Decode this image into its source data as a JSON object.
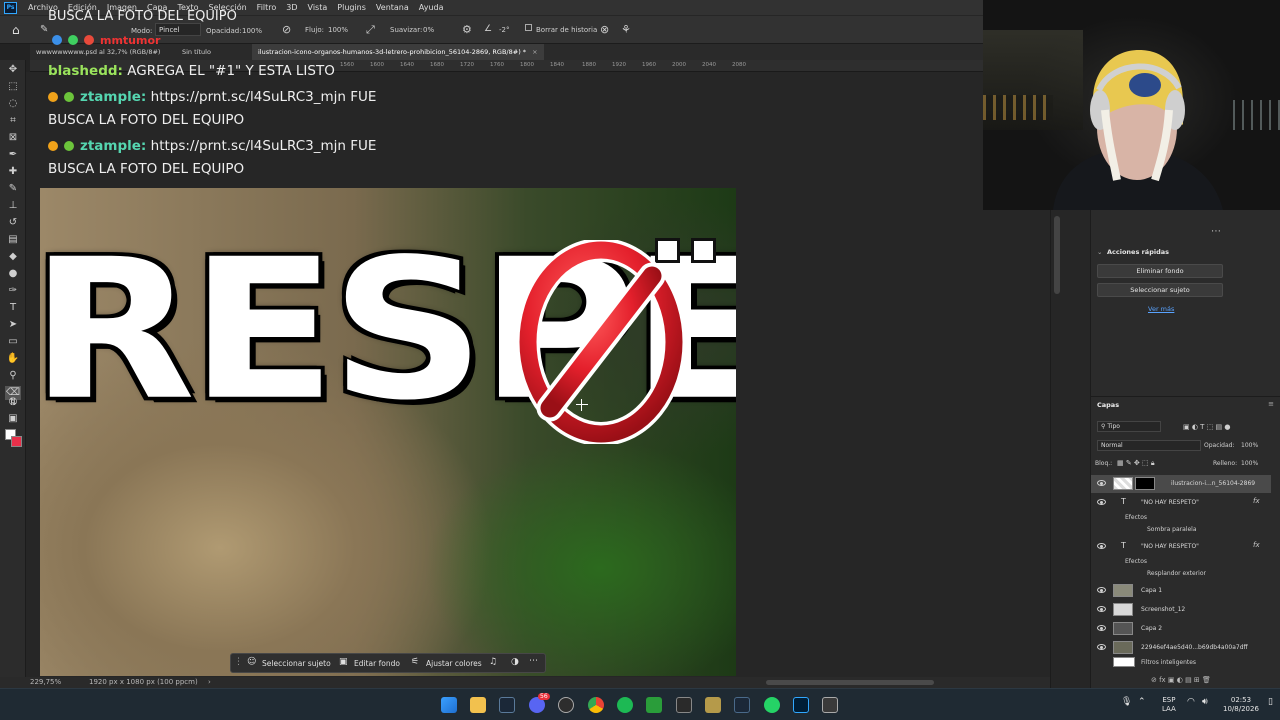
{
  "menu": {
    "items": [
      "Archivo",
      "Edición",
      "Imagen",
      "Capa",
      "Texto",
      "Selección",
      "Filtro",
      "3D",
      "Vista",
      "Plugins",
      "Ventana",
      "Ayuda"
    ]
  },
  "options": {
    "mode_label": "Modo:",
    "mode_value": "Pincel",
    "opacity_label": "Opacidad:",
    "opacity_value": "100%",
    "flow_label": "Flujo:",
    "flow_value": "100%",
    "smooth_label": "Suavizar:",
    "smooth_value": "0%",
    "angle_value": "-2°",
    "history_label": "Borrar de historia"
  },
  "tabs": {
    "tab1": "wwwwwwwww.psd al 32,7% (RGB/8#)",
    "tab2": "Sin título",
    "tab3": "ilustracion-icono-organos-humanos-3d-letrero-prohibicion_56104-2869, RGB/8#) *",
    "close": "×"
  },
  "ruler": {
    "ticks": [
      "1560",
      "1600",
      "1640",
      "1680",
      "1720",
      "1760",
      "1800",
      "1840",
      "1880",
      "1920",
      "1960",
      "2000",
      "2040",
      "2080"
    ]
  },
  "chat": {
    "top_partial": "BUSCA LA FOTO DEL EQUIPO",
    "overlay_name": "mmtumor",
    "messages": [
      {
        "user": "blashedd:",
        "user_color": "#9ae35c",
        "text": " AGREGA EL \"#1\" Y ESTA LISTO"
      },
      {
        "user": "ztample:",
        "user_color": "#55d6b0",
        "text": " https://prnt.sc/l4SuLRC3_mjn FUE",
        "cont": "BUSCA LA FOTO DEL EQUIPO"
      },
      {
        "user": "ztample:",
        "user_color": "#55d6b0",
        "text": " https://prnt.sc/l4SuLRC3_mjn FUE",
        "cont": "BUSCA LA FOTO DEL EQUIPO"
      }
    ]
  },
  "canvas": {
    "headline": "RESPETO",
    "no_sign_color": "#e4202c"
  },
  "context_bar": {
    "select_subject": "Seleccionar sujeto",
    "edit_background": "Editar fondo",
    "adjust_colors": "Ajustar colores"
  },
  "status": {
    "zoom": "229,75%",
    "doc_size": "1920 px x 1080 px (100 ppcm)"
  },
  "properties": {
    "quick_actions_title": "Acciones rápidas",
    "remove_bg": "Eliminar fondo",
    "select_subject": "Seleccionar sujeto",
    "see_more": "Ver más"
  },
  "layers": {
    "title": "Capas",
    "kind_filter": "Tipo",
    "blend_mode": "Normal",
    "opacity_label": "Opacidad:",
    "opacity_value": "100%",
    "lock_label": "Bloq.:",
    "fill_label": "Relleno:",
    "fill_value": "100%",
    "rows": [
      {
        "name": "ilustracion-i...n_56104-2869",
        "kind": "smart"
      },
      {
        "name": "\"NO HAY RESPETO\"",
        "kind": "text",
        "effects": "Efectos",
        "effect": "Sombra paralela"
      },
      {
        "name": "\"NO HAY RESPETO\"",
        "kind": "text",
        "effects": "Efectos",
        "effect": "Resplandor exterior"
      },
      {
        "name": "Capa 1",
        "kind": "image"
      },
      {
        "name": "Screenshot_12",
        "kind": "image"
      },
      {
        "name": "Capa 2",
        "kind": "image"
      },
      {
        "name": "22946ef4ae5d40...b69db4a00a7dff",
        "kind": "smart",
        "filters": "Filtros inteligentes"
      }
    ],
    "fx": "fx"
  },
  "taskbar": {
    "lang_top": "ESP",
    "lang_bottom": "LAA",
    "time": "02:53",
    "date": "10/8/2026",
    "discord_badge": "56"
  }
}
